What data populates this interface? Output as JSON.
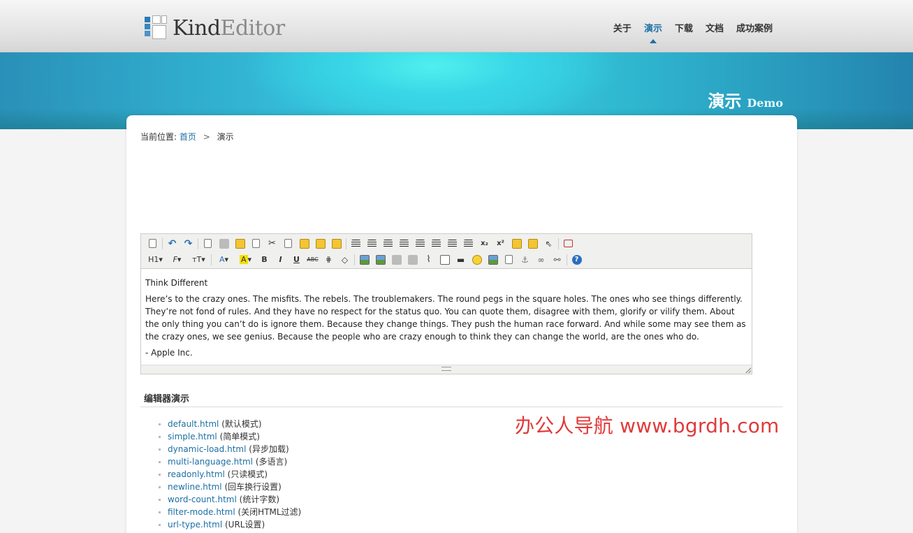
{
  "header": {
    "logo_kind": "Kind",
    "logo_editor": "Editor",
    "nav": [
      "关于",
      "演示",
      "下载",
      "文档",
      "成功案例"
    ]
  },
  "banner": {
    "title_cn": "演示",
    "title_en": "Demo"
  },
  "breadcrumb": {
    "prefix": "当前位置:",
    "home": "首页",
    "separator": ">",
    "current": "演示"
  },
  "toolbar": {
    "row1": [
      "source-icon",
      "undo-icon",
      "redo-icon",
      "preview-icon",
      "print-icon",
      "template-icon",
      "code-icon",
      "cut-icon",
      "copy-icon",
      "paste-icon",
      "paste-plain-icon",
      "paste-word-icon",
      "align-left-icon",
      "align-center-icon",
      "align-right-icon",
      "align-justify-icon",
      "ordered-list-icon",
      "unordered-list-icon",
      "indent-icon",
      "outdent-icon",
      "subscript-icon",
      "superscript-icon",
      "clear-html-icon",
      "quick-format-icon",
      "select-all-icon",
      "fullscreen-icon"
    ],
    "formatblock_label": "H1",
    "fontname_label": "F",
    "fontsize_label": "тT",
    "forecolor_label": "A",
    "hilitecolor_label": "A",
    "bold_label": "B",
    "italic_label": "I",
    "underline_label": "U",
    "strike_label": "ABC"
  },
  "editor": {
    "title": "Think Different",
    "body": "Here’s to the crazy ones. The misfits. The rebels. The troublemakers. The round pegs in the square holes. The ones who see things differently. They’re not fond of rules. And they have no respect for the status quo. You can quote them, disagree with them, glorify or vilify them. About the only thing you can’t do is ignore them. Because they change things. They push the human race forward. And while some may see them as the crazy ones, we see genius. Because the people who are crazy enough to think they can change the world, are the ones who do.",
    "signature": "- Apple Inc."
  },
  "section": {
    "title": "编辑器演示"
  },
  "demos": [
    {
      "link": "default.html",
      "desc": "(默认模式)"
    },
    {
      "link": "simple.html",
      "desc": "(简单模式)"
    },
    {
      "link": "dynamic-load.html",
      "desc": "(异步加载)"
    },
    {
      "link": "multi-language.html",
      "desc": "(多语言)"
    },
    {
      "link": "readonly.html",
      "desc": "(只读模式)"
    },
    {
      "link": "newline.html",
      "desc": "(回车换行设置)"
    },
    {
      "link": "word-count.html",
      "desc": "(统计字数)"
    },
    {
      "link": "filter-mode.html",
      "desc": "(关闭HTML过滤)"
    },
    {
      "link": "url-type.html",
      "desc": "(URL设置)"
    }
  ],
  "watermark": "办公人导航 www.bgrdh.com",
  "colors": {
    "accent": "#1d6fa5",
    "banner": "#37d1e3",
    "watermark": "#e03a3a"
  }
}
